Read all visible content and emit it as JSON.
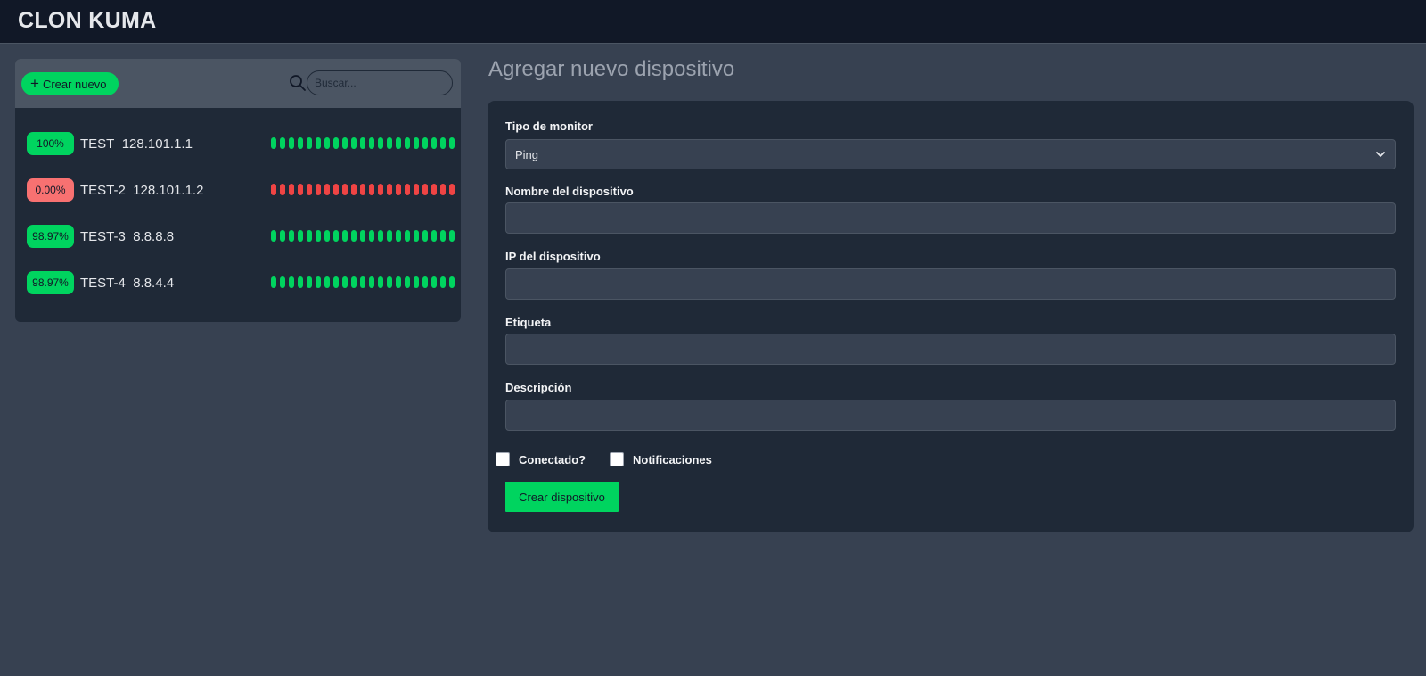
{
  "app": {
    "title": "CLON KUMA"
  },
  "left_panel": {
    "new_button_label": "Crear nuevo",
    "search_placeholder": "Buscar...",
    "devices": [
      {
        "uptime": "100%",
        "status": "up",
        "name": "TEST",
        "ip": "128.101.1.1",
        "beats": 21
      },
      {
        "uptime": "0.00%",
        "status": "down",
        "name": "TEST-2",
        "ip": "128.101.1.2",
        "beats": 21
      },
      {
        "uptime": "98.97%",
        "status": "up",
        "name": "TEST-3",
        "ip": "8.8.8.8",
        "beats": 21
      },
      {
        "uptime": "98.97%",
        "status": "up",
        "name": "TEST-4",
        "ip": "8.8.4.4",
        "beats": 21
      }
    ]
  },
  "form": {
    "title": "Agregar nuevo dispositivo",
    "monitor_type_label": "Tipo de monitor",
    "monitor_type_value": "Ping",
    "device_name_label": "Nombre del dispositivo",
    "device_name_value": "",
    "device_ip_label": "IP del dispositivo",
    "device_ip_value": "",
    "tag_label": "Etiqueta",
    "tag_value": "",
    "description_label": "Descripción",
    "description_value": "",
    "connected_label": "Conectado?",
    "connected_checked": false,
    "notifications_label": "Notificaciones",
    "notifications_checked": false,
    "submit_label": "Crear dispositivo"
  },
  "colors": {
    "background": "#374151",
    "topbar": "#111827",
    "panel": "#1f2937",
    "accent_up": "#00d45f",
    "accent_down": "#ef4444"
  }
}
